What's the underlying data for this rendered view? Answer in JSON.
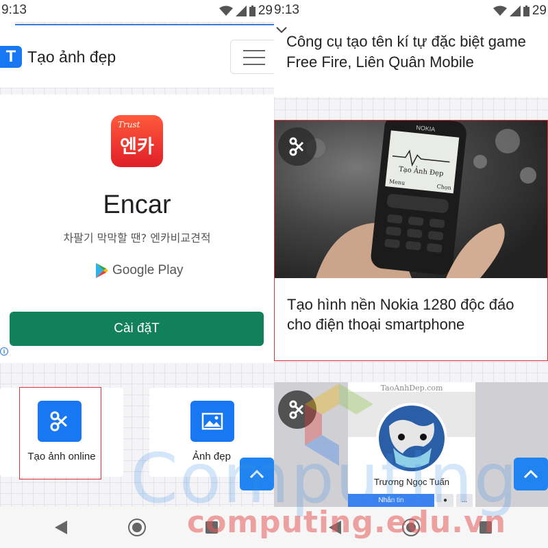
{
  "status_bar": {
    "left_time": "9:13",
    "right_time": "9:13",
    "left_battery": "29",
    "right_battery": "29"
  },
  "left_pane": {
    "site_title": "Tạo ảnh đẹp",
    "logo_letter": "T",
    "ad": {
      "icon_script": "Trust",
      "icon_name": "엔카",
      "app_name": "Encar",
      "app_subtitle": "차팔기 막막할 땐? 엔카비교견적",
      "store_name": "Google Play",
      "install_label": "Cài đặT",
      "info_label": "i"
    },
    "cards": [
      {
        "label": "Tạo ảnh online",
        "icon": "scissors-icon"
      },
      {
        "label": "Ảnh đẹp",
        "icon": "image-icon"
      }
    ]
  },
  "right_pane": {
    "top_post_title": "Công cụ tạo tên kí tự đặc biệt game Free Fire, Liên Quân Mobile",
    "post": {
      "title": "Tạo hình nền Nokia 1280 độc đáo cho điện thoại smartphone",
      "phone_brand": "NOKIA",
      "screen_text": "Tạo Ảnh Đẹp",
      "softkey_left": "Menu",
      "softkey_right": "Chọn"
    },
    "profile_card": {
      "brand": "TaoAnhDep.com",
      "name": "Trương Ngọc Tuấn",
      "message_button": "Nhắn tin",
      "more_button": "..."
    }
  },
  "watermark": {
    "line1": "Computing",
    "line2": "computing.edu.vn"
  },
  "colors": {
    "brand_blue": "#1877f2",
    "install_green": "#12805a",
    "highlight_red": "#e0343a"
  }
}
